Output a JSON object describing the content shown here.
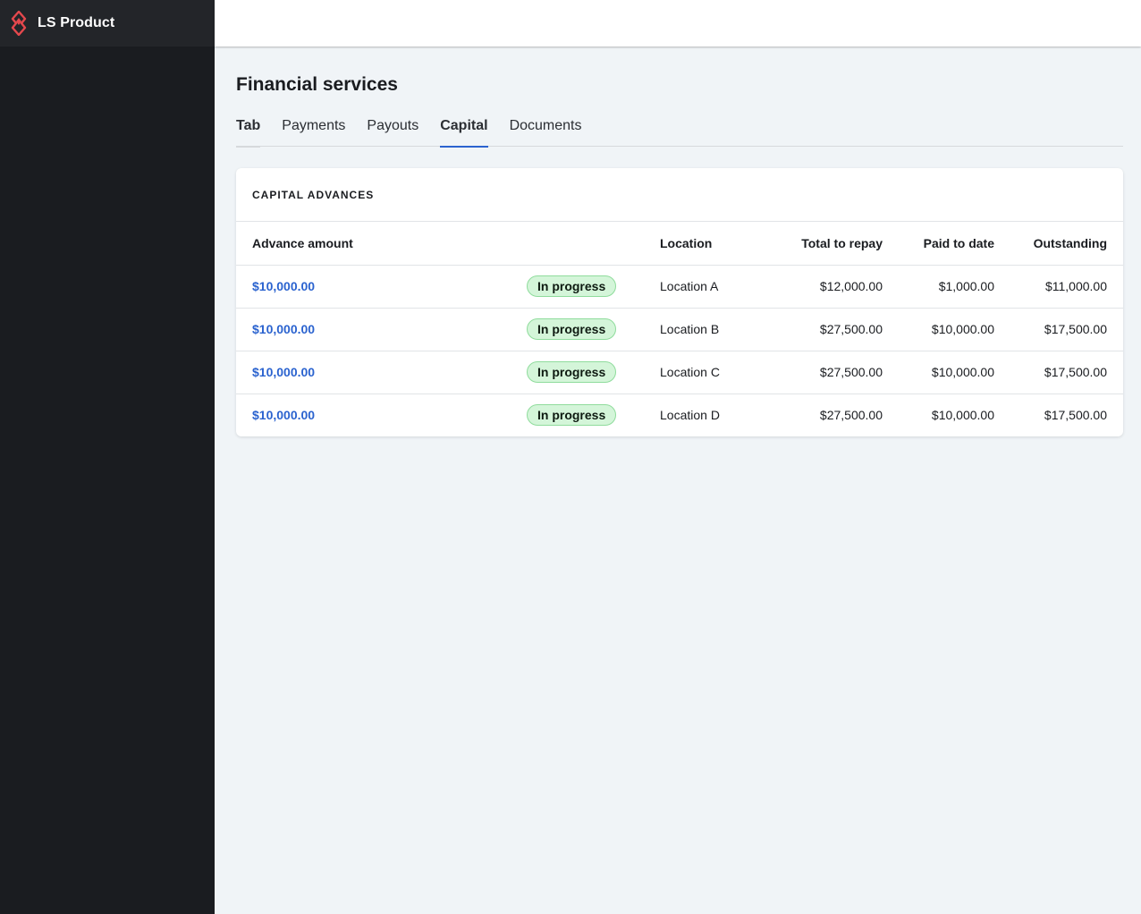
{
  "app": {
    "name": "LS Product",
    "logo_icon": "flame-logo-icon",
    "brand_color": "#e5484d",
    "accent_color": "#2b63cf"
  },
  "page": {
    "title": "Financial services"
  },
  "tabs": [
    {
      "label": "Tab"
    },
    {
      "label": "Payments"
    },
    {
      "label": "Payouts"
    },
    {
      "label": "Capital",
      "active": true
    },
    {
      "label": "Documents"
    }
  ],
  "card": {
    "title": "CAPITAL ADVANCES",
    "columns": {
      "amount": "Advance amount",
      "status": "",
      "location": "Location",
      "total": "Total to repay",
      "paid": "Paid to date",
      "outstanding": "Outstanding"
    },
    "rows": [
      {
        "amount": "$10,000.00",
        "status": "In progress",
        "location": "Location A",
        "total": "$12,000.00",
        "paid": "$1,000.00",
        "outstanding": "$11,000.00"
      },
      {
        "amount": "$10,000.00",
        "status": "In progress",
        "location": "Location B",
        "total": "$27,500.00",
        "paid": "$10,000.00",
        "outstanding": "$17,500.00"
      },
      {
        "amount": "$10,000.00",
        "status": "In progress",
        "location": "Location C",
        "total": "$27,500.00",
        "paid": "$10,000.00",
        "outstanding": "$17,500.00"
      },
      {
        "amount": "$10,000.00",
        "status": "In progress",
        "location": "Location D",
        "total": "$27,500.00",
        "paid": "$10,000.00",
        "outstanding": "$17,500.00"
      }
    ]
  }
}
